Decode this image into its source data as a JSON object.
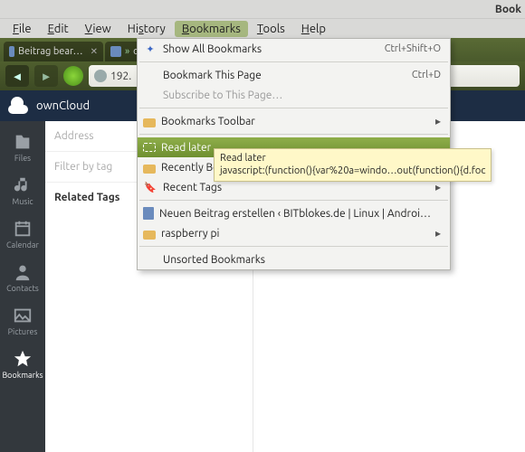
{
  "os": {
    "title_fragment": "Book"
  },
  "menubar": {
    "items": [
      "File",
      "Edit",
      "View",
      "History",
      "Bookmarks",
      "Tools",
      "Help"
    ],
    "open_index": 4
  },
  "tabs": {
    "items": [
      {
        "label": "Beitrag bear…"
      },
      {
        "label": "ow…"
      }
    ]
  },
  "urlbar": {
    "text": "192."
  },
  "owncloud": {
    "brand": "ownCloud",
    "sidebar": [
      {
        "key": "files",
        "label": "Files"
      },
      {
        "key": "music",
        "label": "Music"
      },
      {
        "key": "calendar",
        "label": "Calendar"
      },
      {
        "key": "contacts",
        "label": "Contacts"
      },
      {
        "key": "pictures",
        "label": "Pictures"
      },
      {
        "key": "bookmarks",
        "label": "Bookmarks"
      }
    ],
    "address_placeholder": "Address",
    "filter_placeholder": "Filter by tag",
    "related_tags_label": "Related Tags"
  },
  "bookmarks_menu": {
    "show_all": {
      "label": "Show All Bookmarks",
      "shortcut": "Ctrl+Shift+O"
    },
    "bookmark_this": {
      "label": "Bookmark This Page",
      "shortcut": "Ctrl+D"
    },
    "subscribe": {
      "label": "Subscribe to This Page…"
    },
    "toolbar": {
      "label": "Bookmarks Toolbar"
    },
    "read_later": {
      "label": "Read later"
    },
    "recently": {
      "label": "Recently Bookmarked"
    },
    "recent_tags": {
      "label": "Recent Tags"
    },
    "beitrag": {
      "label": "Neuen Beitrag erstellen ‹ BITblokes.de | Linux | Androi…"
    },
    "raspberry": {
      "label": "raspberry pi"
    },
    "unsorted": {
      "label": "Unsorted Bookmarks"
    }
  },
  "tooltip": {
    "line1": "Read later",
    "line2": "javascript:(function(){var%20a=windo…out(function(){d.foc"
  }
}
